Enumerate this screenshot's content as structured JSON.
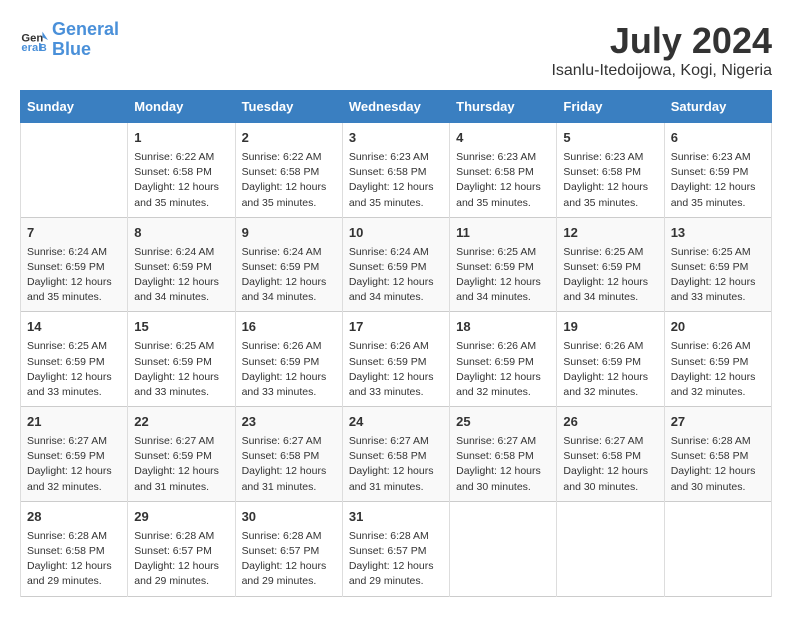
{
  "logo": {
    "line1": "General",
    "line2": "Blue"
  },
  "title": "July 2024",
  "location": "Isanlu-Itedoijowa, Kogi, Nigeria",
  "weekdays": [
    "Sunday",
    "Monday",
    "Tuesday",
    "Wednesday",
    "Thursday",
    "Friday",
    "Saturday"
  ],
  "weeks": [
    [
      {
        "day": "",
        "info": ""
      },
      {
        "day": "1",
        "info": "Sunrise: 6:22 AM\nSunset: 6:58 PM\nDaylight: 12 hours\nand 35 minutes."
      },
      {
        "day": "2",
        "info": "Sunrise: 6:22 AM\nSunset: 6:58 PM\nDaylight: 12 hours\nand 35 minutes."
      },
      {
        "day": "3",
        "info": "Sunrise: 6:23 AM\nSunset: 6:58 PM\nDaylight: 12 hours\nand 35 minutes."
      },
      {
        "day": "4",
        "info": "Sunrise: 6:23 AM\nSunset: 6:58 PM\nDaylight: 12 hours\nand 35 minutes."
      },
      {
        "day": "5",
        "info": "Sunrise: 6:23 AM\nSunset: 6:58 PM\nDaylight: 12 hours\nand 35 minutes."
      },
      {
        "day": "6",
        "info": "Sunrise: 6:23 AM\nSunset: 6:59 PM\nDaylight: 12 hours\nand 35 minutes."
      }
    ],
    [
      {
        "day": "7",
        "info": "Sunrise: 6:24 AM\nSunset: 6:59 PM\nDaylight: 12 hours\nand 35 minutes."
      },
      {
        "day": "8",
        "info": "Sunrise: 6:24 AM\nSunset: 6:59 PM\nDaylight: 12 hours\nand 34 minutes."
      },
      {
        "day": "9",
        "info": "Sunrise: 6:24 AM\nSunset: 6:59 PM\nDaylight: 12 hours\nand 34 minutes."
      },
      {
        "day": "10",
        "info": "Sunrise: 6:24 AM\nSunset: 6:59 PM\nDaylight: 12 hours\nand 34 minutes."
      },
      {
        "day": "11",
        "info": "Sunrise: 6:25 AM\nSunset: 6:59 PM\nDaylight: 12 hours\nand 34 minutes."
      },
      {
        "day": "12",
        "info": "Sunrise: 6:25 AM\nSunset: 6:59 PM\nDaylight: 12 hours\nand 34 minutes."
      },
      {
        "day": "13",
        "info": "Sunrise: 6:25 AM\nSunset: 6:59 PM\nDaylight: 12 hours\nand 33 minutes."
      }
    ],
    [
      {
        "day": "14",
        "info": "Sunrise: 6:25 AM\nSunset: 6:59 PM\nDaylight: 12 hours\nand 33 minutes."
      },
      {
        "day": "15",
        "info": "Sunrise: 6:25 AM\nSunset: 6:59 PM\nDaylight: 12 hours\nand 33 minutes."
      },
      {
        "day": "16",
        "info": "Sunrise: 6:26 AM\nSunset: 6:59 PM\nDaylight: 12 hours\nand 33 minutes."
      },
      {
        "day": "17",
        "info": "Sunrise: 6:26 AM\nSunset: 6:59 PM\nDaylight: 12 hours\nand 33 minutes."
      },
      {
        "day": "18",
        "info": "Sunrise: 6:26 AM\nSunset: 6:59 PM\nDaylight: 12 hours\nand 32 minutes."
      },
      {
        "day": "19",
        "info": "Sunrise: 6:26 AM\nSunset: 6:59 PM\nDaylight: 12 hours\nand 32 minutes."
      },
      {
        "day": "20",
        "info": "Sunrise: 6:26 AM\nSunset: 6:59 PM\nDaylight: 12 hours\nand 32 minutes."
      }
    ],
    [
      {
        "day": "21",
        "info": "Sunrise: 6:27 AM\nSunset: 6:59 PM\nDaylight: 12 hours\nand 32 minutes."
      },
      {
        "day": "22",
        "info": "Sunrise: 6:27 AM\nSunset: 6:59 PM\nDaylight: 12 hours\nand 31 minutes."
      },
      {
        "day": "23",
        "info": "Sunrise: 6:27 AM\nSunset: 6:58 PM\nDaylight: 12 hours\nand 31 minutes."
      },
      {
        "day": "24",
        "info": "Sunrise: 6:27 AM\nSunset: 6:58 PM\nDaylight: 12 hours\nand 31 minutes."
      },
      {
        "day": "25",
        "info": "Sunrise: 6:27 AM\nSunset: 6:58 PM\nDaylight: 12 hours\nand 30 minutes."
      },
      {
        "day": "26",
        "info": "Sunrise: 6:27 AM\nSunset: 6:58 PM\nDaylight: 12 hours\nand 30 minutes."
      },
      {
        "day": "27",
        "info": "Sunrise: 6:28 AM\nSunset: 6:58 PM\nDaylight: 12 hours\nand 30 minutes."
      }
    ],
    [
      {
        "day": "28",
        "info": "Sunrise: 6:28 AM\nSunset: 6:58 PM\nDaylight: 12 hours\nand 29 minutes."
      },
      {
        "day": "29",
        "info": "Sunrise: 6:28 AM\nSunset: 6:57 PM\nDaylight: 12 hours\nand 29 minutes."
      },
      {
        "day": "30",
        "info": "Sunrise: 6:28 AM\nSunset: 6:57 PM\nDaylight: 12 hours\nand 29 minutes."
      },
      {
        "day": "31",
        "info": "Sunrise: 6:28 AM\nSunset: 6:57 PM\nDaylight: 12 hours\nand 29 minutes."
      },
      {
        "day": "",
        "info": ""
      },
      {
        "day": "",
        "info": ""
      },
      {
        "day": "",
        "info": ""
      }
    ]
  ]
}
